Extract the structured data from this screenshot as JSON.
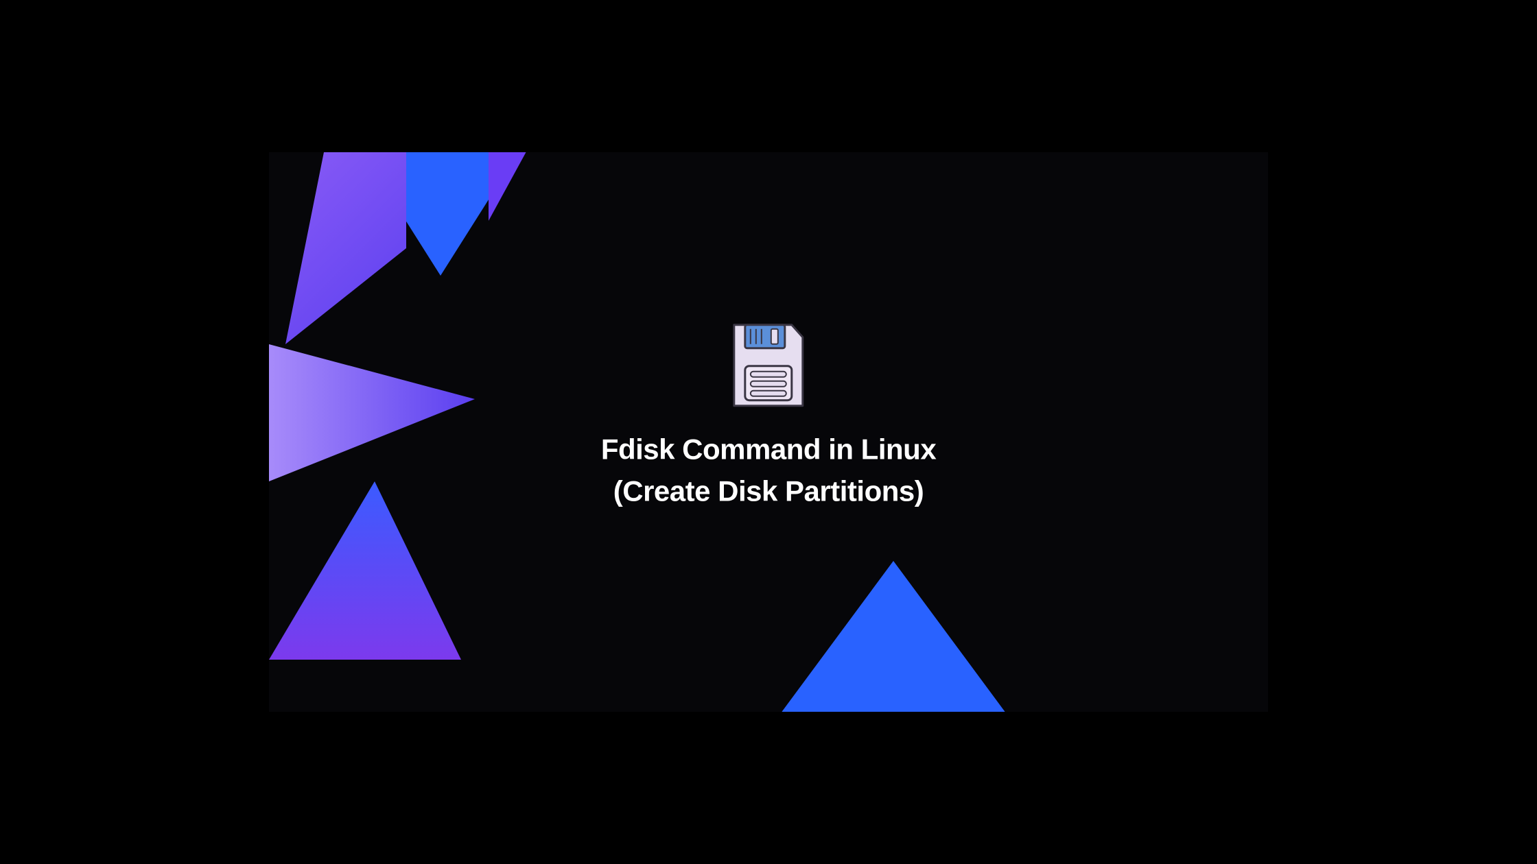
{
  "title_line1": "Fdisk Command in Linux",
  "title_line2": "(Create Disk Partitions)",
  "icon": "floppy-disk",
  "colors": {
    "background": "#060609",
    "text": "#ffffff",
    "blue": "#2962ff",
    "purple": "#7c3aed",
    "floppy_body": "#e6def0",
    "floppy_shutter": "#5b8fd9",
    "floppy_outline": "#3a3644"
  }
}
